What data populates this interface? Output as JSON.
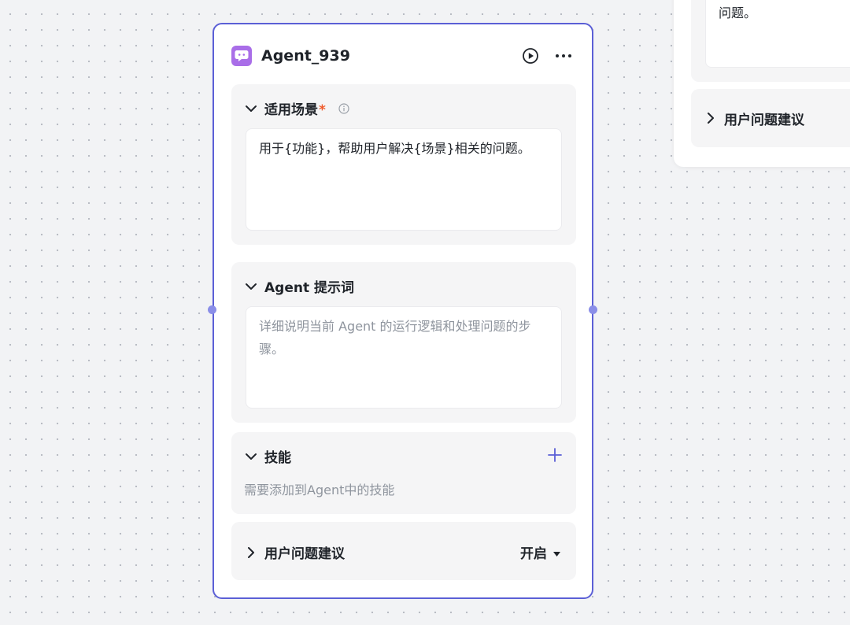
{
  "right_node": {
    "partial_text": "问题。",
    "suggest_label": "用户问题建议"
  },
  "node": {
    "title": "Agent_939",
    "sections": {
      "scenario": {
        "title": "适用场景",
        "required_mark": "*",
        "text": "用于{功能}，帮助用户解决{场景}相关的问题。"
      },
      "prompt": {
        "title": "Agent 提示词",
        "placeholder": "详细说明当前 Agent 的运行逻辑和处理问题的步骤。"
      },
      "skills": {
        "title": "技能",
        "hint": "需要添加到Agent中的技能"
      },
      "suggestions": {
        "title": "用户问题建议",
        "toggle_value": "开启"
      }
    }
  },
  "icons": [
    "chat-bubble-icon",
    "play-icon",
    "more-icon",
    "chevron-down-icon",
    "chevron-right-icon",
    "info-icon",
    "plus-icon",
    "caret-down-icon"
  ],
  "colors": {
    "accent": "#5b5fd6",
    "icon_bg": "#a96ee8",
    "required": "#f05a2a",
    "placeholder": "#8f959e"
  }
}
